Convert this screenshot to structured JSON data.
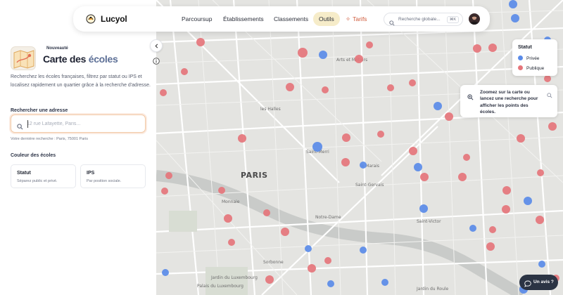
{
  "app": {
    "brand": "Lucyol"
  },
  "nav": {
    "items": [
      "Parcoursup",
      "Établissements",
      "Classements",
      "Outils"
    ],
    "active": "Outils",
    "pricing": "Tarifs",
    "search_placeholder": "Recherche globale...",
    "search_shortcut": "⌘K"
  },
  "panel": {
    "badge": "Nouveauté",
    "title_main": "Carte des ",
    "title_highlight": "écoles",
    "description": "Recherchez les écoles françaises, filtrez par statut ou IPS et localisez rapidement un quartier grâce à la recherche d'adresse.",
    "address_label": "Rechercher une adresse",
    "address_placeholder": "12 rue Lafayette, Paris...",
    "last_search": "Votre dernière recherche : Paris, 75001 Paris",
    "color_label": "Couleur des écoles",
    "cards": [
      {
        "title": "Statut",
        "subtitle": "Séparez public et privé."
      },
      {
        "title": "IPS",
        "subtitle": "Par position sociale."
      }
    ]
  },
  "legend": {
    "title": "Statut",
    "items": [
      {
        "label": "Privée",
        "color": "#5a8be8"
      },
      {
        "label": "Publique",
        "color": "#e5757b"
      }
    ]
  },
  "tooltip": {
    "text": "Zoomez sur la carte ou lancez une recherche pour afficher les points des écoles."
  },
  "feedback": {
    "label": "Un avis ?"
  },
  "map": {
    "city_label": "PARIS",
    "labels": [
      "Arts et Métiers",
      "les Halles",
      "Saint-Merri",
      "le Marais",
      "Saint-Gervais",
      "Monnaie",
      "Notre-Dame",
      "Sorbonne",
      "Saint-Victor",
      "Jardin du Luxembourg",
      "Jardin du Roule",
      "Palais du Luxembourg"
    ]
  },
  "colors": {
    "accent": "#5c6f96",
    "publique": "#e5757b",
    "privee": "#5a8be8",
    "pricing": "#d05c3d",
    "active_bg": "#f6ecc9"
  }
}
